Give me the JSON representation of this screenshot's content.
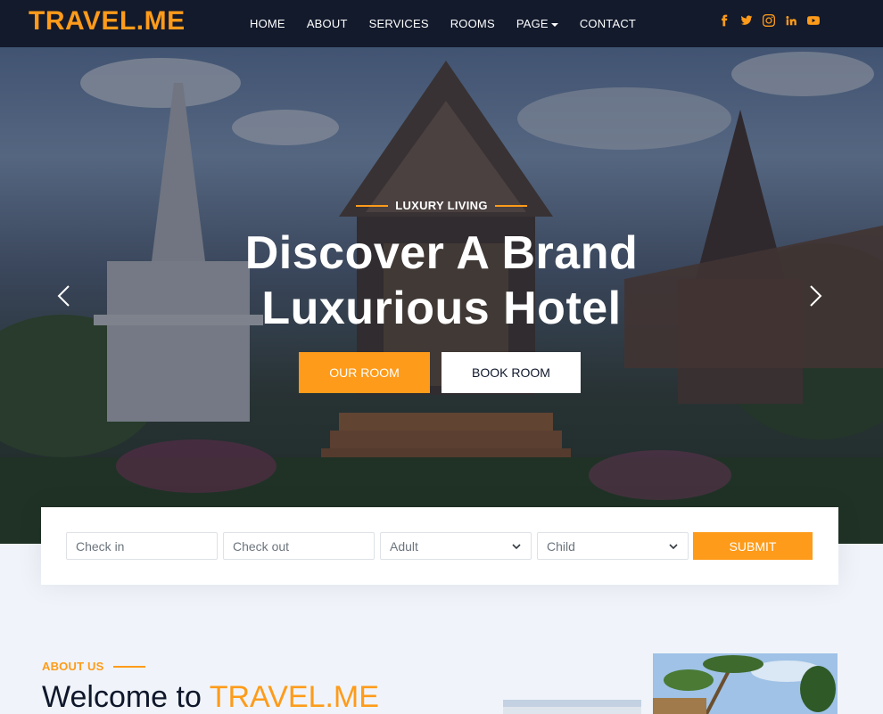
{
  "brand": {
    "name": "TRAVEL.ME"
  },
  "nav": {
    "items": [
      {
        "label": "HOME"
      },
      {
        "label": "ABOUT"
      },
      {
        "label": "SERVICES"
      },
      {
        "label": "ROOMS"
      },
      {
        "label": "PAGE"
      },
      {
        "label": "CONTACT"
      }
    ]
  },
  "social": [
    "facebook-icon",
    "twitter-icon",
    "instagram-icon",
    "linkedin-icon",
    "youtube-icon"
  ],
  "hero": {
    "subtitle": "LUXURY LIVING",
    "title_line1": "Discover A Brand",
    "title_line2": "Luxurious Hotel",
    "btn_primary": "OUR ROOM",
    "btn_secondary": "BOOK ROOM"
  },
  "booking": {
    "checkin_placeholder": "Check in",
    "checkout_placeholder": "Check out",
    "adult_selected": "Adult",
    "child_selected": "Child",
    "submit_label": "SUBMIT"
  },
  "about": {
    "subtitle": "ABOUT US",
    "title_prefix": "Welcome to",
    "title_highlight": "TRAVEL.ME"
  },
  "colors": {
    "accent": "#fe9b1a",
    "nav_bg": "#131a2c",
    "dark_text": "#0f172b",
    "page_bg": "#f0f4fa"
  }
}
